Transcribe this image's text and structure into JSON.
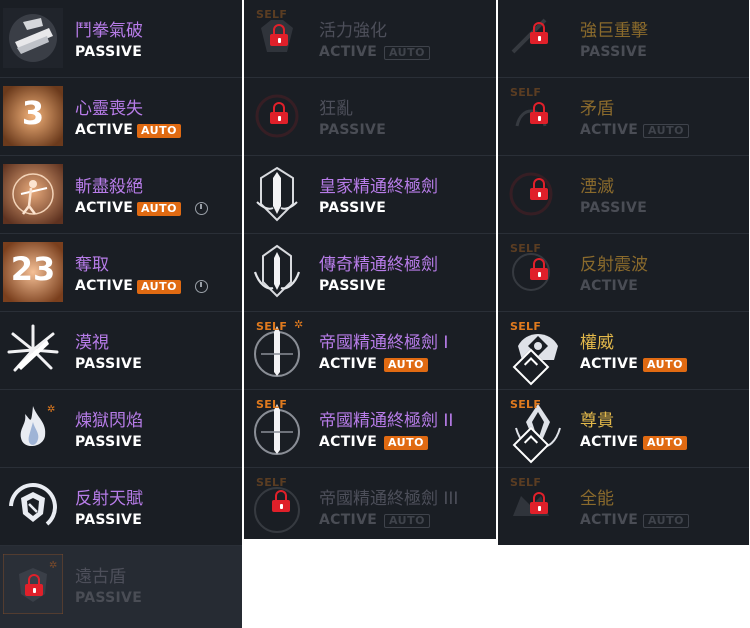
{
  "labels": {
    "passive": "PASSIVE",
    "active": "ACTIVE",
    "auto": "AUTO",
    "self": "SELF"
  },
  "column1": [
    {
      "name": "鬥拳氣破",
      "type": "PASSIVE",
      "auto": false,
      "icon": "fist-icon"
    },
    {
      "name": "心靈喪失",
      "type": "ACTIVE",
      "auto": true,
      "icon_number": "3",
      "icon": "counter-3-icon"
    },
    {
      "name": "斬盡殺絕",
      "type": "ACTIVE",
      "auto": true,
      "timer": true,
      "icon": "archer-icon"
    },
    {
      "name": "奪取",
      "type": "ACTIVE",
      "auto": true,
      "timer": true,
      "icon_number": "23",
      "icon": "counter-23-icon"
    },
    {
      "name": "漠視",
      "type": "PASSIVE",
      "auto": false,
      "icon": "burst-icon"
    },
    {
      "name": "煉獄閃焰",
      "type": "PASSIVE",
      "auto": false,
      "icon": "flame-icon"
    },
    {
      "name": "反射天賦",
      "type": "PASSIVE",
      "auto": false,
      "icon": "shield-ring-icon"
    },
    {
      "name": "遠古盾",
      "type": "PASSIVE",
      "auto": false,
      "locked": true,
      "icon": "ancient-shield-icon"
    }
  ],
  "column2": [
    {
      "name": "活力強化",
      "type": "ACTIVE",
      "auto": true,
      "locked": true,
      "self": true
    },
    {
      "name": "狂亂",
      "type": "PASSIVE",
      "auto": false,
      "locked": true
    },
    {
      "name": "皇家精通終極劍",
      "type": "PASSIVE",
      "auto": false,
      "icon": "royal-sword-icon"
    },
    {
      "name": "傳奇精通終極劍",
      "type": "PASSIVE",
      "auto": false,
      "icon": "legend-sword-icon"
    },
    {
      "name": "帝國精通終極劍 I",
      "type": "ACTIVE",
      "auto": true,
      "self": true,
      "icon": "empire-sword-icon"
    },
    {
      "name": "帝國精通終極劍 II",
      "type": "ACTIVE",
      "auto": true,
      "self": true,
      "icon": "empire-sword-icon"
    },
    {
      "name": "帝國精通終極劍 III",
      "type": "ACTIVE",
      "auto": true,
      "locked": true,
      "self": true
    }
  ],
  "column3": [
    {
      "name": "強巨重擊",
      "type": "PASSIVE",
      "auto": false,
      "locked": true
    },
    {
      "name": "矛盾",
      "type": "ACTIVE",
      "auto": true,
      "locked": true,
      "self": true
    },
    {
      "name": "湮滅",
      "type": "PASSIVE",
      "auto": false,
      "locked": true
    },
    {
      "name": "反射震波",
      "type": "ACTIVE",
      "auto": false,
      "locked": true,
      "self": true
    },
    {
      "name": "權威",
      "type": "ACTIVE",
      "auto": true,
      "self": true,
      "icon": "authority-icon"
    },
    {
      "name": "尊貴",
      "type": "ACTIVE",
      "auto": true,
      "self": true,
      "icon": "noble-icon"
    },
    {
      "name": "全能",
      "type": "ACTIVE",
      "auto": true,
      "locked": true,
      "self": true
    }
  ],
  "colors": {
    "name_purple": "#b77ce8",
    "name_gold_locked": "#8a6a2c",
    "auto_orange": "#e06a12",
    "lock_red": "#e0202a",
    "panel_bg": "#1a1e24"
  }
}
